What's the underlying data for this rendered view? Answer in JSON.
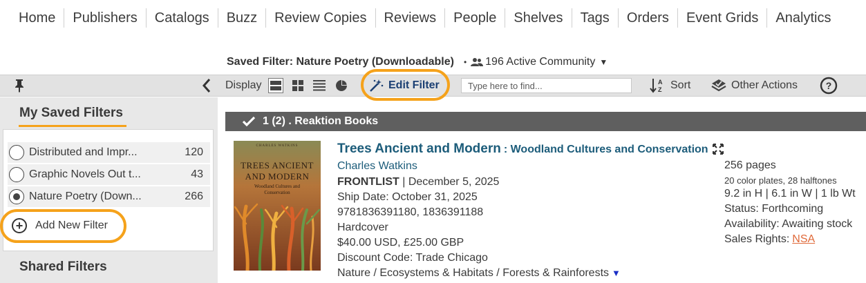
{
  "nav": {
    "items": [
      "Home",
      "Publishers",
      "Catalogs",
      "Buzz",
      "Review Copies",
      "Reviews",
      "People",
      "Shelves",
      "Tags",
      "Orders",
      "Event Grids",
      "Analytics"
    ]
  },
  "saved_filter": {
    "label": "Saved Filter: Nature Poetry (Downloadable)",
    "bullet": "•",
    "community": "196 Active Community"
  },
  "toolbar": {
    "display_label": "Display",
    "edit_filter_label": "Edit Filter",
    "search_placeholder": "Type here to find...",
    "sort_label": "Sort",
    "other_actions_label": "Other Actions"
  },
  "sidebar": {
    "my_saved_filters_heading": "My Saved Filters",
    "filters": [
      {
        "name": "Distributed and Impr...",
        "count": "120",
        "selected": false
      },
      {
        "name": "Graphic Novels Out t...",
        "count": "43",
        "selected": false
      },
      {
        "name": "Nature Poetry (Down...",
        "count": "266",
        "selected": true
      }
    ],
    "add_filter_label": "Add New Filter",
    "shared_filters_heading": "Shared Filters"
  },
  "group": {
    "header": "1 (2) . Reaktion Books"
  },
  "book": {
    "cover": {
      "author": "CHARLES WATKINS",
      "title_line1": "TREES ANCIENT",
      "title_line2": "AND MODERN",
      "sub_line1": "Woodland Cultures and",
      "sub_line2": "Conservation"
    },
    "title": "Trees Ancient and Modern",
    "subtitle": ": Woodland Cultures and Conservation",
    "author": "Charles Watkins",
    "frontlist_label": "FRONTLIST",
    "pub_date": "| December 5, 2025",
    "ship_date": "Ship Date: October 31, 2025",
    "isbn": "9781836391180, 1836391188",
    "format": "Hardcover",
    "price": "$40.00 USD, £25.00 GBP",
    "discount": "Discount Code: Trade Chicago",
    "subject": "Nature / Ecosystems & Habitats / Forests & Rainforests",
    "pages": "256 pages",
    "illustrations": "20 color plates, 28 halftones",
    "dimensions": "9.2 in H | 6.1 in W | 1 lb Wt",
    "status": "Status: Forthcoming",
    "availability": "Availability: Awaiting stock",
    "sales_rights_label": "Sales Rights:",
    "sales_rights_value": "NSA"
  },
  "colors": {
    "highlight_ring": "#f5a21b",
    "link_blue": "#1c5c7a",
    "edit_filter_blue": "#1b3f73",
    "group_header_bg": "#5f5f5f",
    "nsa_link": "#e06a3a"
  }
}
